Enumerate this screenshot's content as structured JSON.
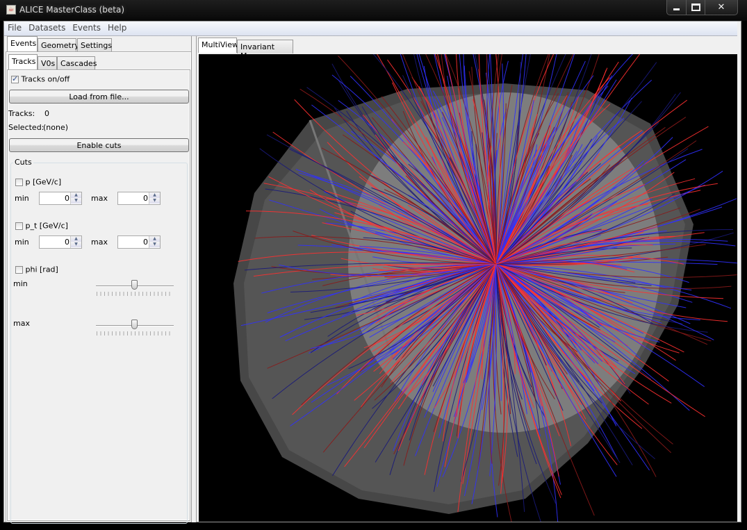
{
  "window": {
    "title": "ALICE MasterClass (beta)",
    "controls": {
      "minimize": "▁",
      "maximize": "□",
      "close": "✕"
    }
  },
  "menu": [
    "File",
    "Datasets",
    "Events",
    "Help"
  ],
  "left_tabs": [
    "Events",
    "Geometry",
    "Settings"
  ],
  "left_tab_selected": "Events",
  "sub_tabs": [
    "Tracks",
    "V0s",
    "Cascades"
  ],
  "sub_tab_selected": "Tracks",
  "tracks_panel": {
    "tracks_toggle_label": "Tracks on/off",
    "tracks_toggle_checked": true,
    "load_button": "Load from file...",
    "tracks_label": "Tracks:",
    "tracks_value": "0",
    "selected_label": "Selected:",
    "selected_value": "(none)",
    "enable_cuts_button": "Enable cuts",
    "cuts_group_label": "Cuts",
    "cuts": {
      "p": {
        "label": "p [GeV/c]",
        "checked": false,
        "min_label": "min",
        "min_value": "0",
        "max_label": "max",
        "max_value": "0"
      },
      "pt": {
        "label": "p_t [GeV/c]",
        "checked": false,
        "min_label": "min",
        "min_value": "0",
        "max_label": "max",
        "max_value": "0"
      },
      "phi": {
        "label": "phi [rad]",
        "checked": false,
        "min_label": "min",
        "max_label": "max",
        "min_slider_fraction": 0.5,
        "max_slider_fraction": 0.5
      }
    }
  },
  "right_tabs": [
    "MultiView",
    "Invariant Mass"
  ],
  "right_tab_selected": "MultiView",
  "viewer": {
    "description": "3D event display of particle tracks in ALICE detector",
    "track_colors": {
      "positive": "#ff3030",
      "negative": "#3030ff",
      "dark_red": "#8a1a1a",
      "dark_blue": "#1a1a7a"
    },
    "detector_colors": {
      "outer": "#4a4a4a",
      "mid": "#5c5c5c",
      "inner": "#8a8a8a"
    }
  }
}
